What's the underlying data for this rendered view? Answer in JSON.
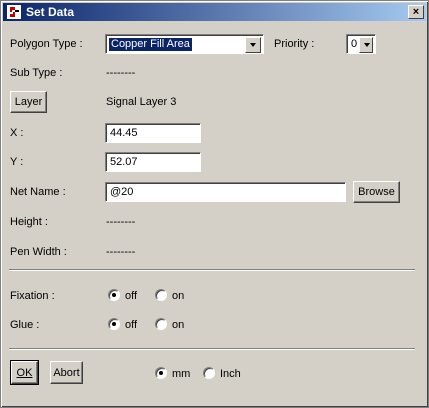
{
  "window": {
    "title": "Set Data",
    "close_glyph": "×"
  },
  "polygon_type": {
    "label": "Polygon Type :",
    "value": "Copper Fill Area"
  },
  "priority": {
    "label": "Priority :",
    "value": "0"
  },
  "sub_type": {
    "label": "Sub Type :",
    "value": "--------"
  },
  "layer": {
    "button_label": "Layer",
    "value": "Signal Layer 3"
  },
  "x": {
    "label": "X :",
    "value": "44.45"
  },
  "y": {
    "label": "Y :",
    "value": "52.07"
  },
  "net_name": {
    "label": "Net Name :",
    "value": "@20",
    "browse_label": "Browse"
  },
  "height": {
    "label": "Height :",
    "value": "--------"
  },
  "pen_width": {
    "label": "Pen Width :",
    "value": "--------"
  },
  "fixation": {
    "label": "Fixation :",
    "off_label": "off",
    "on_label": "on",
    "selected": "off"
  },
  "glue": {
    "label": "Glue :",
    "off_label": "off",
    "on_label": "on",
    "selected": "off"
  },
  "units": {
    "mm_label": "mm",
    "inch_label": "Inch",
    "selected": "mm"
  },
  "buttons": {
    "ok_label": "OK",
    "abort_label": "Abort"
  }
}
